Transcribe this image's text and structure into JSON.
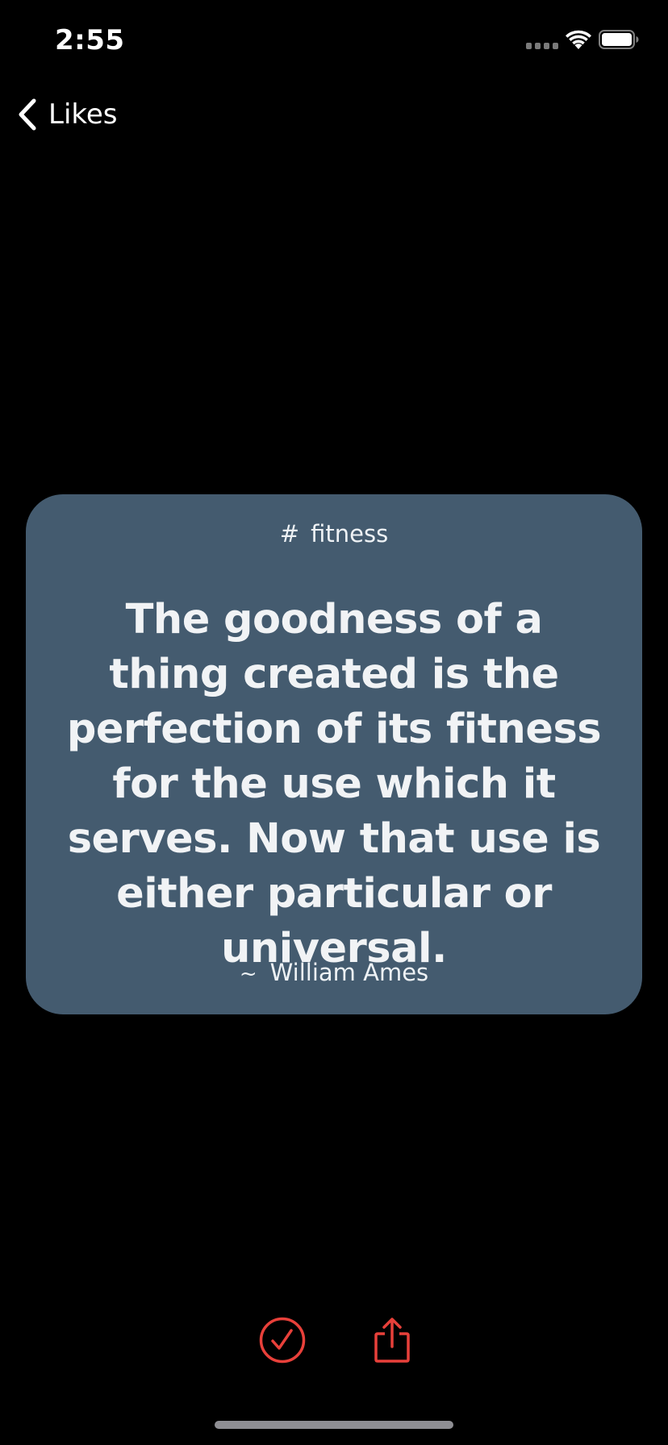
{
  "status_bar": {
    "time": "2:55"
  },
  "nav": {
    "back_label": "Likes"
  },
  "quote": {
    "tag_symbol": "#",
    "tag": "fitness",
    "text": "The goodness of a thing created is the perfection of its fitness for the use which it serves. Now that use is either particular or universal.",
    "author_prefix": "~",
    "author": "William Ames",
    "card_color": "#445b6f"
  },
  "actions": {
    "accent_color": "#e8403a",
    "check_icon": "checkmark-circle-icon",
    "share_icon": "share-icon"
  }
}
